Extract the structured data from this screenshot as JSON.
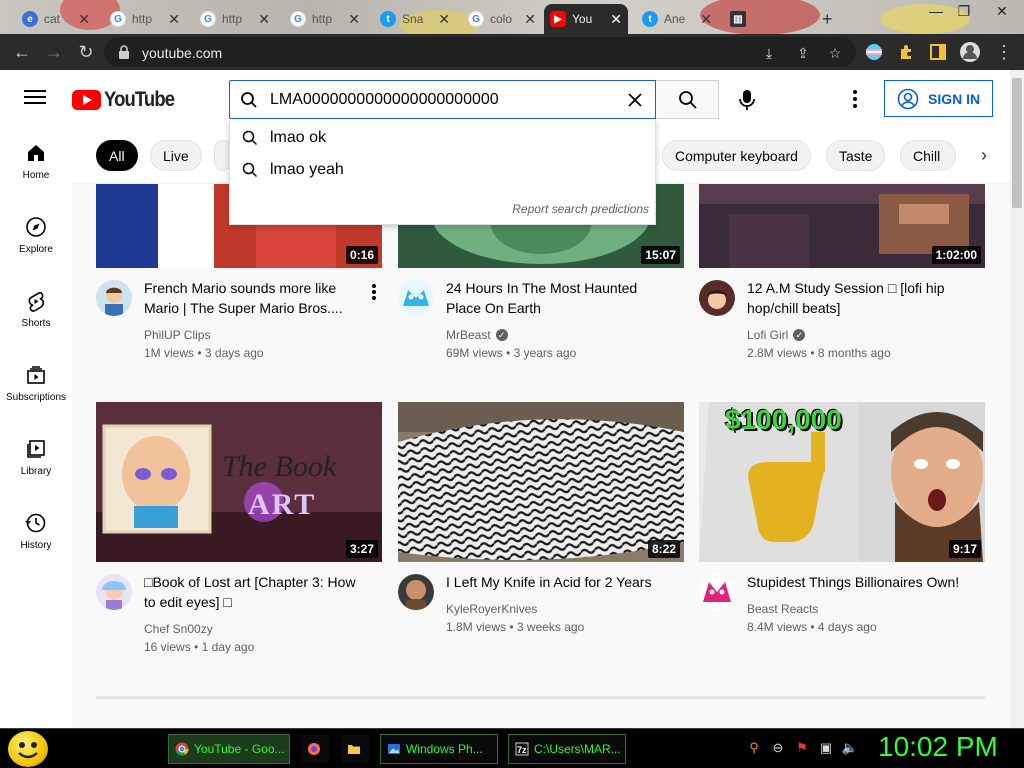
{
  "browser": {
    "tabs": [
      {
        "label": "cat",
        "color": "#3d6fd8"
      },
      {
        "label": "http",
        "color": "#4285f4"
      },
      {
        "label": "http",
        "color": "#4285f4"
      },
      {
        "label": "http",
        "color": "#4285f4"
      },
      {
        "label": "Sna",
        "color": "#1d9bf0"
      },
      {
        "label": "colo",
        "color": "#4285f4"
      },
      {
        "label": "You",
        "color": "#ff0000"
      },
      {
        "label": "Ane",
        "color": "#1d9bf0"
      }
    ],
    "new_tab": "+",
    "url": "youtube.com"
  },
  "youtube": {
    "logo_text": "YouTube",
    "search": {
      "value": "LMA0000000000000000000000",
      "suggestions": [
        "lmao ok",
        "lmao yeah"
      ],
      "report": "Report search predictions"
    },
    "signin_label": "SIGN IN",
    "chips": [
      "All",
      "Live",
      "Computer keyboard",
      "Taste",
      "Chill"
    ],
    "sidebar": [
      "Home",
      "Explore",
      "Shorts",
      "Subscriptions",
      "Library",
      "History"
    ],
    "videos": [
      {
        "title": "French Mario sounds more like Mario | The Super Mario Bros....",
        "channel": "PhilUP Clips",
        "verified": false,
        "views": "1M views",
        "age": "3 days ago",
        "duration": "0:16"
      },
      {
        "title": "24 Hours In The Most Haunted Place On Earth",
        "channel": "MrBeast",
        "verified": true,
        "views": "69M views",
        "age": "3 years ago",
        "duration": "15:07"
      },
      {
        "title": "12 A.M Study Session □ [lofi hip hop/chill beats]",
        "channel": "Lofi Girl",
        "verified": true,
        "views": "2.8M views",
        "age": "8 months ago",
        "duration": "1:02:00"
      },
      {
        "title": "□Book of Lost art [Chapter 3: How to edit eyes] □",
        "channel": "Chef Sn00zy",
        "verified": false,
        "views": "16 views",
        "age": "1 day ago",
        "duration": "3:27"
      },
      {
        "title": "I Left My Knife in Acid for 2 Years",
        "channel": "KyleRoyerKnives",
        "verified": false,
        "views": "1.8M views",
        "age": "3 weeks ago",
        "duration": "8:22"
      },
      {
        "title": "Stupidest Things Billionaires Own!",
        "channel": "Beast Reacts",
        "verified": false,
        "views": "8.4M views",
        "age": "4 days ago",
        "duration": "9:17"
      }
    ],
    "thumb_text": {
      "price": "$100,000",
      "book": "The Book",
      "book2": "ART"
    }
  },
  "taskbar": {
    "tasks": [
      "YouTube - Goo...",
      "Windows Ph...",
      "C:\\Users\\MAR..."
    ],
    "clock": "10:02 PM"
  },
  "colors": {
    "accent": "#065fd4",
    "brand": "#ff0000",
    "taskbar_text": "#22ff22"
  }
}
